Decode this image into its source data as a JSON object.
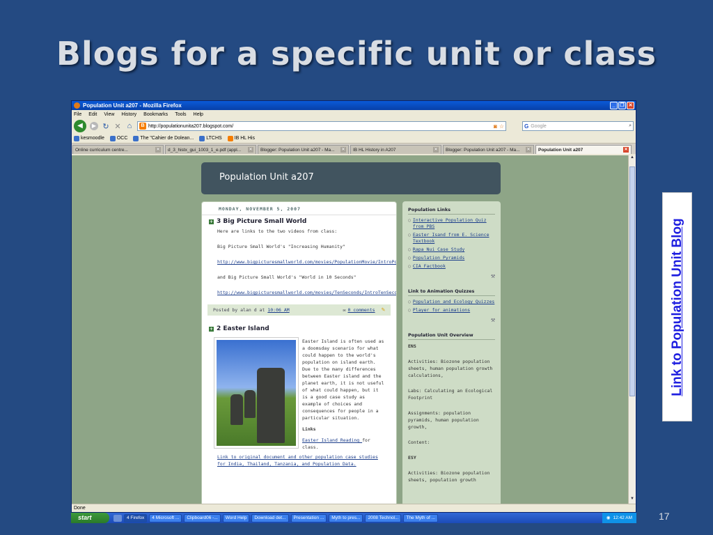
{
  "slide": {
    "title": "Blogs for a specific unit or class",
    "side_link": "Link to Population Unit Blog",
    "page_number": "17"
  },
  "browser": {
    "window_title": "Population Unit a207 - Mozilla Firefox",
    "menu": [
      "File",
      "Edit",
      "View",
      "History",
      "Bookmarks",
      "Tools",
      "Help"
    ],
    "url": "http://populationunita207.blogspot.com/",
    "search_placeholder": "Google",
    "bookmarks": [
      "kesmoodle",
      "OCC",
      "The \"Cahier de Dolean...",
      "LTCHS",
      "IB HL His"
    ],
    "tabs": [
      {
        "label": "Online curriculum centre..."
      },
      {
        "label": "d_3_histx_gui_1003_1_e.pdf (appl..."
      },
      {
        "label": "Blogger: Population Unit a207 - Ma..."
      },
      {
        "label": "IB HL History in A207"
      },
      {
        "label": "Blogger: Population Unit a207 - Ma..."
      },
      {
        "label": "Population Unit a207"
      }
    ],
    "status": "Done"
  },
  "blog": {
    "title": "Population Unit a207",
    "date_header": "MONDAY, NOVEMBER 5, 2007",
    "post1": {
      "title": "3 Big Picture Small World",
      "intro": "Here are links to the two videos from class:",
      "line1": "Big Picture Small World's \"Increasing Humanity\"",
      "link1": "http://www.bigpicturesmallworld.com/movies/PopulationMovie/IntroPop2.html",
      "line2": "and Big Picture Small World's \"World in 10 Seconds\"",
      "link2": "http://www.bigpicturesmallworld.com/movies/TenSeconds/IntroTenSeconds.html",
      "posted_by": "Posted by alan d at",
      "time": "10:06 AM",
      "comments": "0 comments"
    },
    "post2": {
      "title": "2 Easter Island",
      "text": "Easter Island is often used as a doomsday scenario for what could happen to the world's population on island earth. Due to the many differences between Easter island and the planet earth, it is not useful of what could happen, but it is a good case study as example of choices and consequences for people in a particular situation.",
      "links_heading": "Links",
      "reading_link": "Easter Island Reading ",
      "reading_suffix": "for class.",
      "doc_link": "Link to original document and other population case studies for India, Thailand, Tanzania, and Population Data."
    },
    "sidebar": {
      "pop_links_heading": "Population Links",
      "pop_links": [
        "Interactive Population Quiz from PBS",
        "Easter Isand from E. Science Textbook",
        "Rapa Nui Case Study",
        "Population Pyramids",
        "CIA Factbook"
      ],
      "anim_heading": "Link to Animation Quizzes",
      "anim_links": [
        "Population and Ecology Quizzes",
        "Player for animations"
      ],
      "overview_heading": "Population Unit Overview",
      "ens": "ENS",
      "activities": "Activities: Biozone population sheets, human population growth calculations,",
      "labs": "Labs: Calculating an Ecological Footprint",
      "assignments": "Assignments: population pyramids, human population growth,",
      "content": "Content:",
      "esy": "ESY",
      "activities2": "Activities: Biozone population sheets, population growth"
    }
  },
  "taskbar": {
    "start": "start",
    "tasks": [
      "4 Firefox",
      "4 Microsoft ...",
      "Clipboard06 -...",
      "Word Help",
      "Download det...",
      "Presentation ...",
      "Myth to pres...",
      "2008 Technol...",
      "The Myth of ..."
    ],
    "clock": "12:42 AM"
  }
}
